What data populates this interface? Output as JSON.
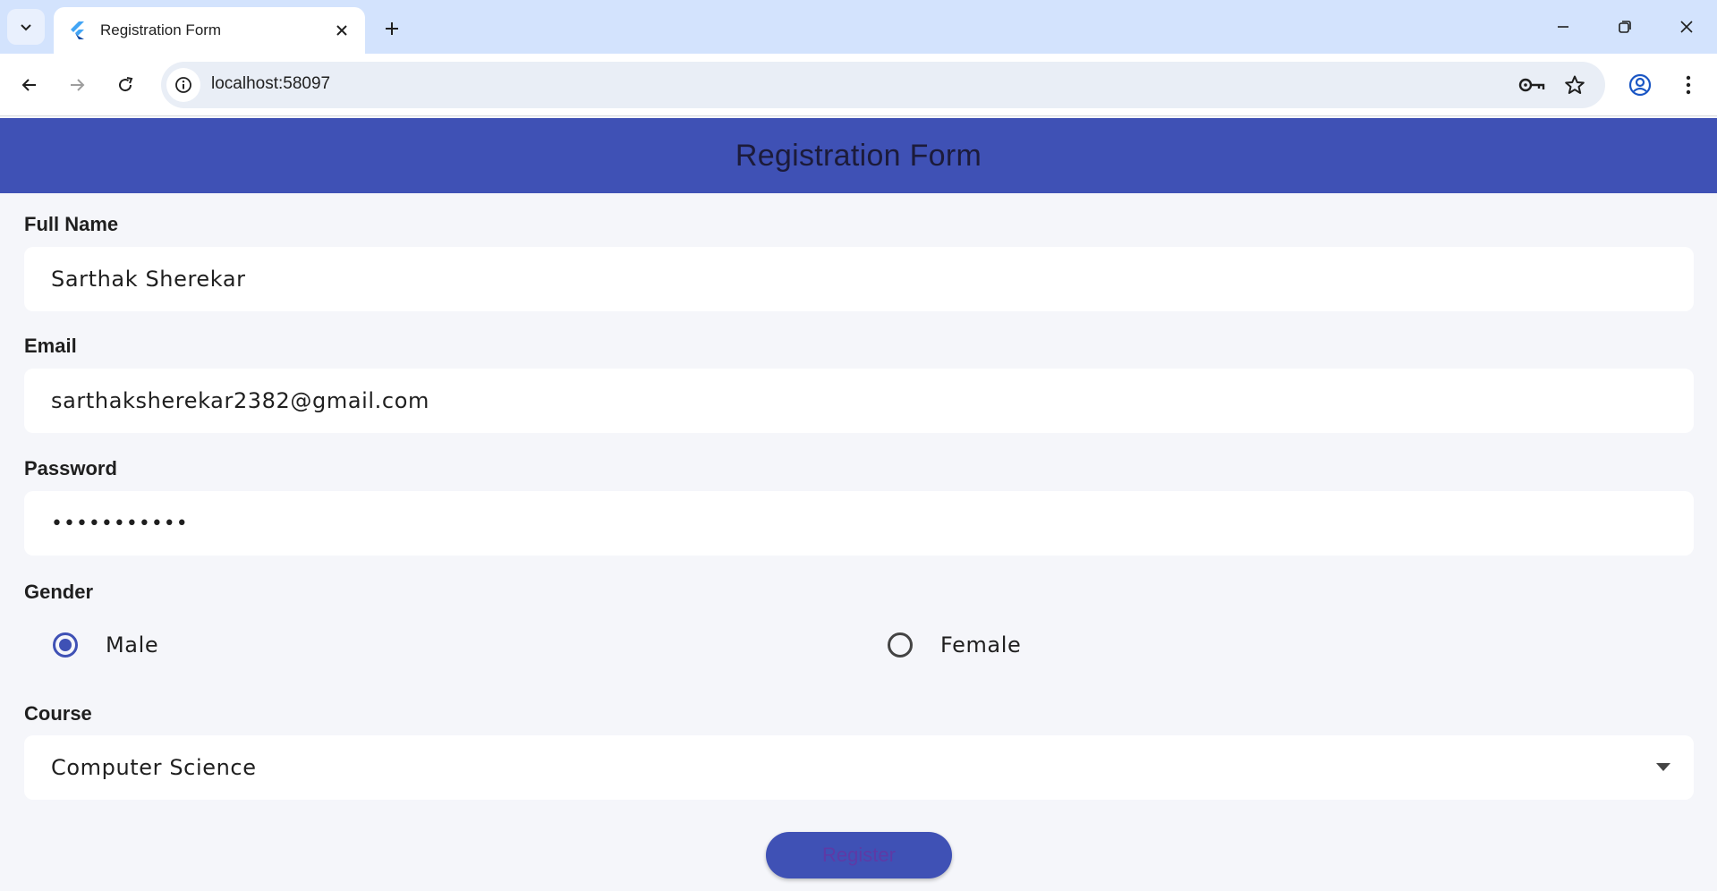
{
  "browser": {
    "tab_title": "Registration Form",
    "url": "localhost:58097",
    "icons": {
      "tab_search": "chevron-down-icon",
      "favicon": "flutter-icon",
      "tab_close": "close-icon",
      "new_tab": "plus-icon",
      "minimize": "minimize-icon",
      "restore": "restore-icon",
      "window_close": "close-icon",
      "back": "arrow-left-icon",
      "forward": "arrow-right-icon",
      "reload": "reload-icon",
      "site_info": "info-icon",
      "password": "key-icon",
      "bookmark": "star-icon",
      "profile": "account-icon",
      "menu": "kebab-menu-icon"
    }
  },
  "app": {
    "title": "Registration Form",
    "accent_color": "#3f51b5",
    "form": {
      "full_name": {
        "label": "Full Name",
        "value": "Sarthak Sherekar"
      },
      "email": {
        "label": "Email",
        "value": "sarthaksherekar2382@gmail.com"
      },
      "password": {
        "label": "Password",
        "value": "•••••••••••"
      },
      "gender": {
        "label": "Gender",
        "options": [
          "Male",
          "Female"
        ],
        "selected": "Male"
      },
      "course": {
        "label": "Course",
        "value": "Computer Science"
      },
      "submit_label": "Register"
    }
  }
}
